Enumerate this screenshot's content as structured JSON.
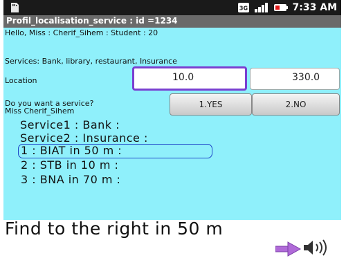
{
  "status": {
    "time": "7:33 AM",
    "sd_icon": "sd-card-icon",
    "net_icon": "3g-icon",
    "signal_icon": "signal-icon",
    "battery_icon": "battery-icon"
  },
  "app": {
    "title": "Profil_localisation_service : id =1234"
  },
  "greeting": "Hello,  Miss  : Cherif_Sihem  : Student  : 20",
  "services_line": "Services: Bank, library, restaurant, Insurance",
  "location": {
    "label": "Location",
    "value1": "10.0",
    "value2": "330.0"
  },
  "question": {
    "line1": "Do you want a service?",
    "line2": "Miss Cherif_Sihem",
    "yes": "1.YES",
    "no": "2.NO"
  },
  "services": {
    "s1": "Service1  : Bank  :",
    "s2": "Service2  : Insurance  :"
  },
  "results": [
    "1  :  BIAT in 50 m  :",
    "2  :  STB in 10 m  :",
    "3  :  BNA in 70 m  :"
  ],
  "direction": {
    "text": "Find to the right in 50 m",
    "arrow_icon": "right-arrow-icon",
    "speaker_icon": "speaker-icon"
  },
  "colors": {
    "background": "#8ff0fb",
    "statusbar": "#1a1a1a",
    "titlebar": "#6a6a6a",
    "focus": "#7a3fd0",
    "selection": "#1d44c8",
    "arrow": "#b06ad8"
  }
}
